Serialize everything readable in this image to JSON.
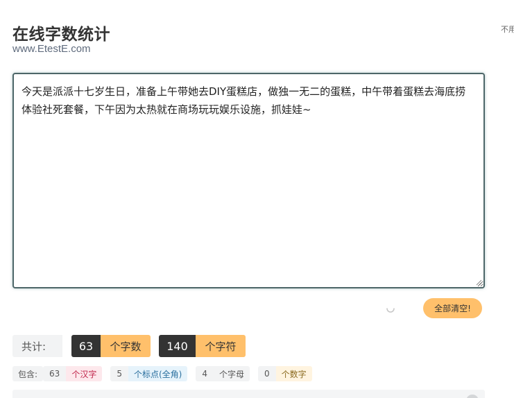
{
  "header": {
    "title": "在线字数统计",
    "site": "www.EtestE.com",
    "side_note": "不用"
  },
  "editor": {
    "content": "今天是派派十七岁生日，准备上午带她去DIY蛋糕店，做独一无二的蛋糕，中午带着蛋糕去海底捞体验社死套餐，下午因为太热就在商场玩玩娱乐设施，抓娃娃~"
  },
  "actions": {
    "clear_label": "全部清空!"
  },
  "totals": {
    "label": "共计:",
    "word_count": "63",
    "word_unit": "个字数",
    "char_count": "140",
    "char_unit": "个字符"
  },
  "details": {
    "label": "包含:",
    "items": [
      {
        "count": "63",
        "unit": "个汉字"
      },
      {
        "count": "5",
        "unit": "个标点(全角)"
      },
      {
        "count": "4",
        "unit": "个字母"
      },
      {
        "count": "0",
        "unit": "个数字"
      }
    ]
  },
  "colors": {
    "accent": "#ffc06b",
    "dark": "#333333",
    "editor_border": "#4d6668"
  }
}
